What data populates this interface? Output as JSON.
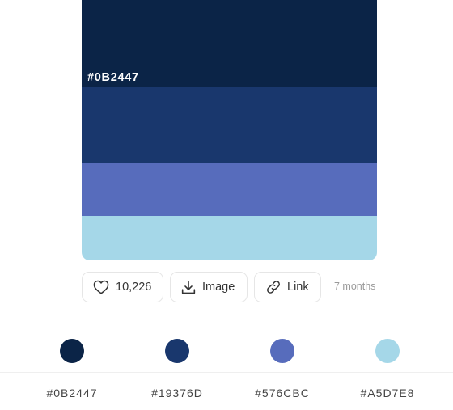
{
  "palette": {
    "colors": [
      {
        "hex": "#0B2447",
        "label": "#0B2447"
      },
      {
        "hex": "#19376D",
        "label": ""
      },
      {
        "hex": "#576CBC",
        "label": ""
      },
      {
        "hex": "#A5D7E8",
        "label": ""
      }
    ]
  },
  "actions": {
    "like_count": "10,226",
    "image_label": "Image",
    "link_label": "Link",
    "time_ago": "7 months"
  },
  "icons": {
    "like": "heart-icon",
    "image": "download-icon",
    "link": "link-icon"
  },
  "chips": [
    {
      "hex": "#0B2447",
      "label": "#0B2447"
    },
    {
      "hex": "#19376D",
      "label": "#19376D"
    },
    {
      "hex": "#576CBC",
      "label": "#576CBC"
    },
    {
      "hex": "#A5D7E8",
      "label": "#A5D7E8"
    }
  ]
}
